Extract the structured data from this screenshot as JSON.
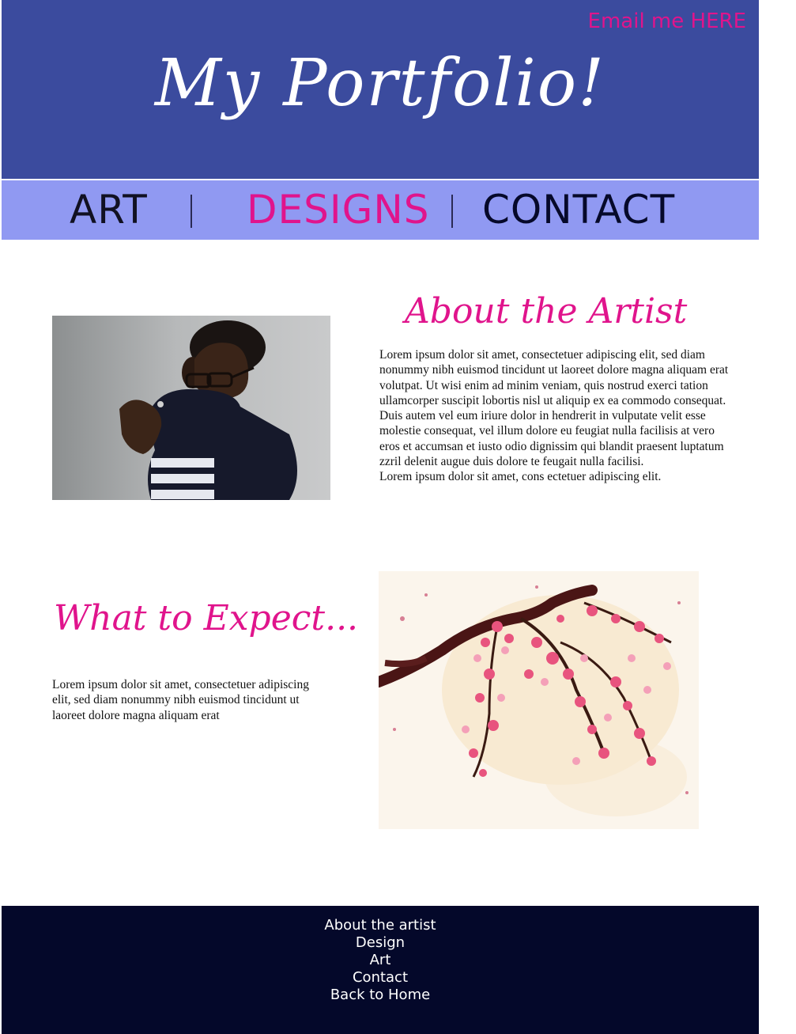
{
  "header": {
    "email_link": "Email me HERE",
    "title": "My Portfolio!"
  },
  "nav": {
    "art": "ART",
    "designs": "DESIGNS",
    "contact": "CONTACT",
    "active": "DESIGNS"
  },
  "about": {
    "heading": "About the Artist",
    "text": "Lorem ipsum dolor sit amet, consectetuer adipiscing elit, sed diam nonummy nibh euismod tincidunt ut laoreet dolore magna aliquam erat volutpat. Ut wisi enim ad minim veniam, quis nostrud exerci tation ullamcorper suscipit lobortis nisl ut aliquip ex ea commodo consequat. Duis autem vel eum iriure dolor in hendrerit in vulputate velit esse molestie consequat, vel illum dolore eu feugiat nulla facilisis at vero eros et accumsan et iusto odio dignissim qui blandit praesent luptatum zzril delenit augue duis dolore te feugait nulla facilisi.",
    "text2": "Lorem ipsum dolor sit amet, cons ectetuer adipiscing elit."
  },
  "expect": {
    "heading": "What to Expect...",
    "text": "Lorem ipsum dolor sit amet, consectetuer adipiscing elit, sed diam nonummy nibh euismod tincidunt ut laoreet dolore magna aliquam erat"
  },
  "footer": {
    "links": [
      "About the artist",
      "Design",
      "Art",
      "Contact",
      "Back to Home"
    ]
  },
  "colors": {
    "header_bg": "#3b4b9e",
    "nav_bg": "#9099f2",
    "accent": "#e0148c",
    "footer_bg": "#04082a"
  },
  "icons": {
    "artist_photo": "artist-photo",
    "painting": "cherry-blossom-painting"
  }
}
